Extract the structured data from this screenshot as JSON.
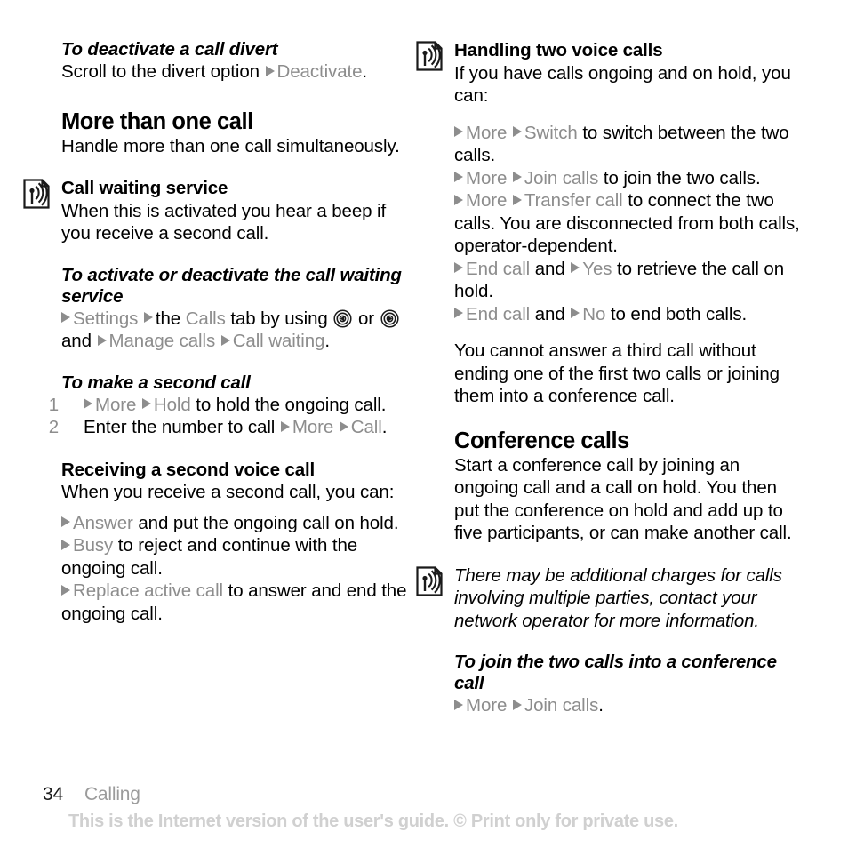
{
  "document": {
    "page_number": "34",
    "chapter": "Calling",
    "disclaimer": "This is the Internet version of the user's guide. © Print only for private use."
  },
  "left_column": {
    "proc_deactivate_divert": {
      "title": "To deactivate a call divert",
      "line_prefix": "Scroll to the divert option",
      "ui_deactivate": "Deactivate",
      "line_suffix": "."
    },
    "section_more_than_one_call": {
      "title": "More than one call",
      "intro": "Handle more than one call simultaneously."
    },
    "call_waiting_service": {
      "icon": "note-signal-icon",
      "title": "Call waiting service",
      "body": "When this is activated you hear a beep if you receive a second call."
    },
    "proc_activate_call_waiting": {
      "title": "To activate or deactivate the call waiting service",
      "ui_settings": "Settings",
      "text_the": "the",
      "ui_calls": "Calls",
      "text_tab_by_using": "tab by using",
      "icon_nav_left": "nav-key-left-icon",
      "text_or": "or",
      "icon_nav_right": "nav-key-right-icon",
      "text_and": "and",
      "ui_manage_calls": "Manage calls",
      "ui_call_waiting": "Call waiting",
      "period": "."
    },
    "proc_make_second_call": {
      "title": "To make a second call",
      "steps": [
        {
          "num": "1",
          "ui_1": "More",
          "ui_2": "Hold",
          "text": "to hold the ongoing call."
        },
        {
          "num": "2",
          "text_lead": "Enter the number to call",
          "ui_1": "More",
          "ui_2": "Call",
          "period": "."
        }
      ]
    },
    "receiving_second_voice_call": {
      "title": "Receiving a second voice call",
      "intro": "When you receive a second call, you can:",
      "options": [
        {
          "ui": "Answer",
          "text": "and put the ongoing call on hold."
        },
        {
          "ui": "Busy",
          "text": "to reject and continue with the ongoing call."
        },
        {
          "ui": "Replace active call",
          "text": "to answer and end the ongoing call."
        }
      ]
    }
  },
  "right_column": {
    "handling_two_voice_calls": {
      "icon": "note-signal-icon",
      "title": "Handling two voice calls",
      "body": "If you have calls ongoing and on hold, you can:"
    },
    "two_call_options": [
      {
        "ui_1": "More",
        "ui_2": "Switch",
        "text": "to switch between the two calls."
      },
      {
        "ui_1": "More",
        "ui_2": "Join calls",
        "text": "to join the two calls."
      },
      {
        "ui_1": "More",
        "ui_2": "Transfer call",
        "text": "to connect the two calls. You are disconnected from both calls, operator-dependent."
      },
      {
        "ui_1": "End call",
        "mid": "and",
        "ui_2": "Yes",
        "text": "to retrieve the call on hold."
      },
      {
        "ui_1": "End call",
        "mid": "and",
        "ui_2": "No",
        "text": "to end both calls."
      }
    ],
    "third_call_note": "You cannot answer a third call without ending one of the first two calls or joining them into a conference call.",
    "section_conference_calls": {
      "title": "Conference calls",
      "intro": "Start a conference call by joining an ongoing call and a call on hold. You then put the conference on hold and add up to five participants, or can make another call."
    },
    "charges_note": {
      "icon": "note-signal-icon",
      "text": "There may be additional charges for calls involving multiple parties, contact your network operator for more information."
    },
    "proc_join_two_calls": {
      "title": "To join the two calls into a conference call",
      "ui_1": "More",
      "ui_2": "Join calls",
      "period": "."
    }
  },
  "colors": {
    "ui_term_gray": "#8d8d8d",
    "text_black": "#000000",
    "footer_chapter_gray": "#9b9b9b",
    "footer_disclaimer_gray": "#d0d0d0"
  }
}
